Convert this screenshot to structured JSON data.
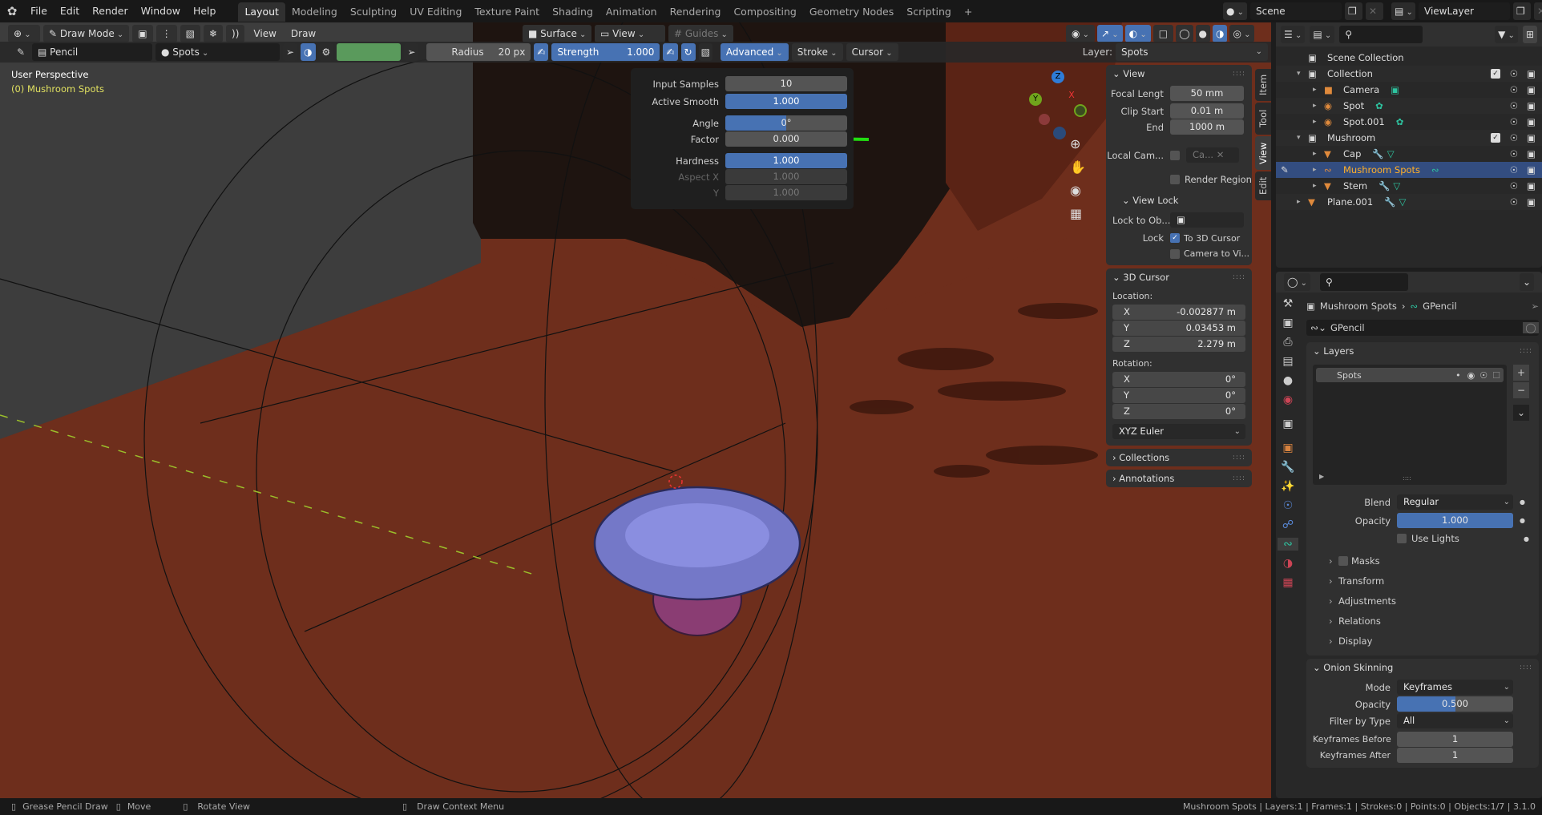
{
  "topbar": {
    "menus": [
      "File",
      "Edit",
      "Render",
      "Window",
      "Help"
    ],
    "workspaces": [
      "Layout",
      "Modeling",
      "Sculpting",
      "UV Editing",
      "Texture Paint",
      "Shading",
      "Animation",
      "Rendering",
      "Compositing",
      "Geometry Nodes",
      "Scripting"
    ],
    "active_workspace": "Layout",
    "add_tab": "+",
    "scene": "Scene",
    "view_layer": "ViewLayer"
  },
  "header": {
    "mode": "Draw Mode",
    "view": "View",
    "draw": "Draw",
    "surface": "Surface",
    "view_dd": "View",
    "guides": "Guides"
  },
  "toolsettings": {
    "brush": "Pencil",
    "material": "Spots",
    "radius_label": "Radius",
    "radius_value": "20 px",
    "strength_label": "Strength",
    "strength_value": "1.000",
    "advanced": "Advanced",
    "stroke": "Stroke",
    "cursor": "Cursor",
    "layer_label": "Layer:",
    "layer_value": "Spots",
    "color": "#5a9a5c"
  },
  "viewport": {
    "perspective": "User Perspective",
    "object": "(0) Mushroom Spots",
    "gizmo": {
      "z": "Z",
      "y": "Y",
      "x": "X"
    }
  },
  "popup": {
    "rows": [
      {
        "label": "Input Samples",
        "value": "10",
        "style": "normal"
      },
      {
        "label": "Active Smooth",
        "value": "1.000",
        "style": "blue"
      },
      {
        "label": "Angle",
        "value": "0°",
        "style": "half"
      },
      {
        "label": "Factor",
        "value": "0.000",
        "style": "normal"
      },
      {
        "label": "Hardness",
        "value": "1.000",
        "style": "blue"
      },
      {
        "label": "Aspect X",
        "value": "1.000",
        "style": "dis"
      },
      {
        "label": "Y",
        "value": "1.000",
        "style": "dis"
      }
    ]
  },
  "npanel": {
    "tabs": [
      "Item",
      "Tool",
      "View",
      "Edit"
    ],
    "active_tab": "View",
    "view": {
      "title": "View",
      "focal_label": "Focal Lengt",
      "focal": "50 mm",
      "clip_start_label": "Clip Start",
      "clip_start": "0.01 m",
      "end_label": "End",
      "end": "1000 m",
      "local_cam_label": "Local Cam...",
      "local_cam": "Ca...",
      "render_region": "Render Region"
    },
    "view_lock": {
      "title": "View Lock",
      "lock_to_obj": "Lock to Ob...",
      "lock": "Lock",
      "to_3d_cursor": "To 3D Cursor",
      "camera_to_view": "Camera to Vi..."
    },
    "cursor": {
      "title": "3D Cursor",
      "location": "Location:",
      "loc": [
        {
          "axis": "X",
          "value": "-0.002877 m"
        },
        {
          "axis": "Y",
          "value": "0.03453 m"
        },
        {
          "axis": "Z",
          "value": "2.279 m"
        }
      ],
      "rotation": "Rotation:",
      "rot": [
        {
          "axis": "X",
          "value": "0°"
        },
        {
          "axis": "Y",
          "value": "0°"
        },
        {
          "axis": "Z",
          "value": "0°"
        }
      ],
      "mode": "XYZ Euler"
    },
    "collections": "Collections",
    "annotations": "Annotations"
  },
  "outliner": {
    "items": [
      {
        "name": "Scene Collection",
        "depth": 0,
        "type": "collection"
      },
      {
        "name": "Collection",
        "depth": 1,
        "type": "collection"
      },
      {
        "name": "Camera",
        "depth": 2,
        "type": "camera"
      },
      {
        "name": "Spot",
        "depth": 2,
        "type": "light"
      },
      {
        "name": "Spot.001",
        "depth": 2,
        "type": "light"
      },
      {
        "name": "Mushroom",
        "depth": 1,
        "type": "collection"
      },
      {
        "name": "Cap",
        "depth": 2,
        "type": "mesh"
      },
      {
        "name": "Mushroom Spots",
        "depth": 2,
        "type": "gpencil",
        "selected": true
      },
      {
        "name": "Stem",
        "depth": 2,
        "type": "mesh"
      },
      {
        "name": "Plane.001",
        "depth": 1,
        "type": "mesh"
      }
    ]
  },
  "properties": {
    "breadcrumb_object": "Mushroom Spots",
    "breadcrumb_data": "GPencil",
    "data_name": "GPencil",
    "layers_title": "Layers",
    "layer_item": "Spots",
    "blend_label": "Blend",
    "blend": "Regular",
    "opacity_label": "Opacity",
    "opacity": "1.000",
    "opacity_fraction": 1.0,
    "use_lights": "Use Lights",
    "subpanels": [
      "Masks",
      "Transform",
      "Adjustments",
      "Relations",
      "Display"
    ],
    "onion": {
      "title": "Onion Skinning",
      "mode_label": "Mode",
      "mode": "Keyframes",
      "opacity_label": "Opacity",
      "opacity": "0.500",
      "opacity_fraction": 0.5,
      "filter_label": "Filter by Type",
      "filter": "All",
      "before_label": "Keyframes Before",
      "before": "1",
      "after_label": "Keyframes After",
      "after": "1"
    }
  },
  "statusbar": {
    "hints": [
      "Grease Pencil Draw",
      "Move",
      "Rotate View",
      "Draw Context Menu"
    ],
    "info": "Mushroom Spots | Layers:1 | Frames:1 | Strokes:0 | Points:0 | Objects:1/7 | 3.1.0"
  }
}
